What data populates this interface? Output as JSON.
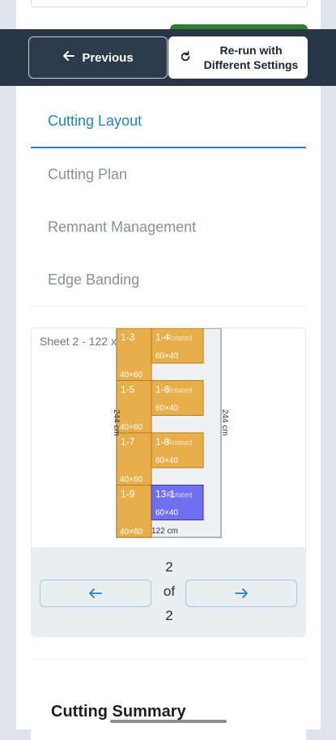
{
  "header": {
    "previous_label": "Previous",
    "rerun_label_line1": "Re-run with",
    "rerun_label_line2": "Different Settings"
  },
  "tabs": [
    {
      "label": "Cutting Layout",
      "active": true
    },
    {
      "label": "Cutting Plan",
      "active": false
    },
    {
      "label": "Remnant Management",
      "active": false
    },
    {
      "label": "Edge Banding",
      "active": false
    }
  ],
  "sheet": {
    "label": "Sheet 2 - 122 x",
    "width_label": "122 cm",
    "height_label": "244 cm",
    "height_label_left": "244 cm",
    "pieces": [
      {
        "id": "1-3",
        "size": "40×60",
        "rotated": false,
        "color": "#e7ae49"
      },
      {
        "id": "1-4",
        "size": "60×40",
        "rotated": true,
        "color": "#e7ae49"
      },
      {
        "id": "1-5",
        "size": "40×60",
        "rotated": false,
        "color": "#e7ae49"
      },
      {
        "id": "1-6",
        "size": "60×40",
        "rotated": true,
        "color": "#e7ae49"
      },
      {
        "id": "1-7",
        "size": "40×60",
        "rotated": false,
        "color": "#e7ae49"
      },
      {
        "id": "1-8",
        "size": "60×40",
        "rotated": true,
        "color": "#e7ae49"
      },
      {
        "id": "1-9",
        "size": "40×60",
        "rotated": false,
        "color": "#e7ae49"
      },
      {
        "id": "13-1",
        "size": "60×40",
        "rotated": true,
        "color": "#6f6ff0"
      }
    ],
    "rotated_label": "Rotated"
  },
  "pager": {
    "current": "2",
    "of_label": "of",
    "total": "2",
    "prev_icon": "arrow-left-icon",
    "next_icon": "arrow-right-icon"
  },
  "summary": {
    "title": "Cutting Summary"
  },
  "colors": {
    "accent": "#1e86c7",
    "header_bg": "#283646",
    "piece_orange": "#e7ae49",
    "piece_blue": "#6f6ff0"
  }
}
